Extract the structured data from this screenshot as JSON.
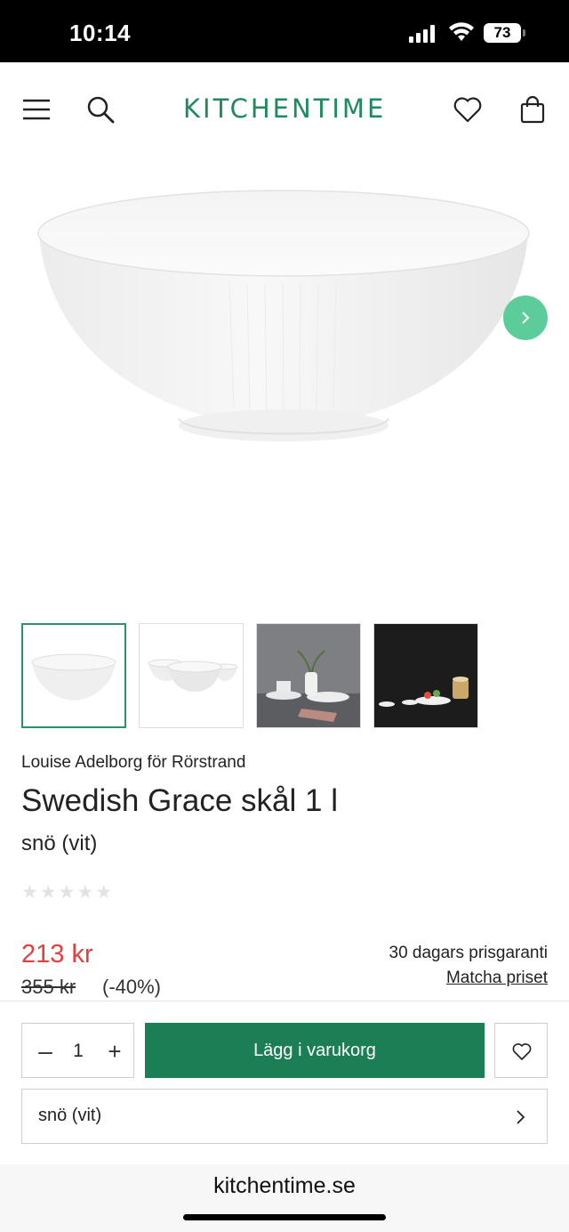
{
  "status_bar": {
    "time": "10:14",
    "battery": "73"
  },
  "header": {
    "logo": "KITCHENTIME"
  },
  "gallery": {
    "thumbnails": [
      {
        "name": "thumb-bowl-single"
      },
      {
        "name": "thumb-bowl-set"
      },
      {
        "name": "thumb-table-setting"
      },
      {
        "name": "thumb-dark-setting"
      }
    ]
  },
  "product": {
    "brand": "Louise Adelborg för Rörstrand",
    "title": "Swedish Grace skål 1 l",
    "variant": "snö (vit)",
    "rating": 0,
    "price": "213 kr",
    "old_price": "355 kr",
    "discount": "(-40%)",
    "guarantee": "30 dagars prisgaranti",
    "match_price": "Matcha priset"
  },
  "cart": {
    "quantity": "1",
    "minus": "–",
    "plus": "+",
    "add_label": "Lägg i varukorg",
    "variant_select": "snö (vit)"
  },
  "browser": {
    "url": "kitchentime.se"
  },
  "colors": {
    "brand_green": "#1b7e55",
    "accent_green": "#5ccd9a",
    "sale_red": "#e1403f"
  }
}
